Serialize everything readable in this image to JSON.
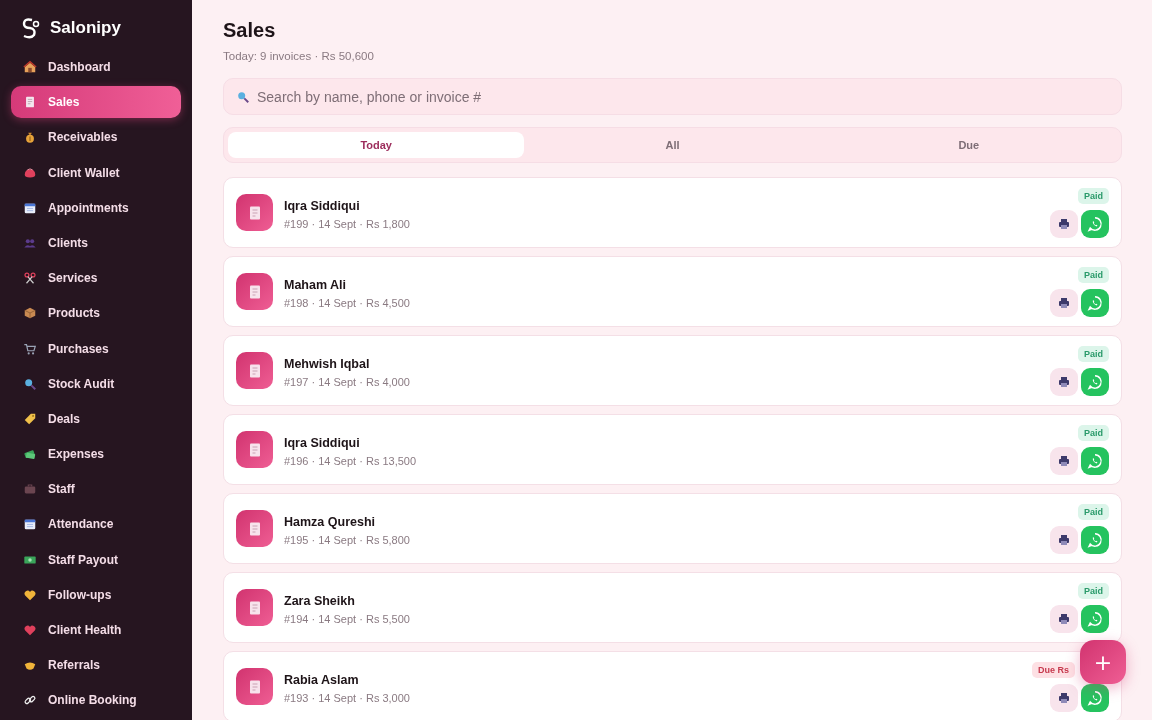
{
  "app": {
    "name": "Salonipy"
  },
  "sidebar": {
    "items": [
      {
        "label": "Dashboard",
        "selected": false
      },
      {
        "label": "Sales",
        "selected": true
      },
      {
        "label": "Receivables",
        "selected": false
      },
      {
        "label": "Client Wallet",
        "selected": false
      },
      {
        "label": "Appointments",
        "selected": false
      },
      {
        "label": "Clients",
        "selected": false
      },
      {
        "label": "Services",
        "selected": false
      },
      {
        "label": "Products",
        "selected": false
      },
      {
        "label": "Purchases",
        "selected": false
      },
      {
        "label": "Stock Audit",
        "selected": false
      },
      {
        "label": "Deals",
        "selected": false
      },
      {
        "label": "Expenses",
        "selected": false
      },
      {
        "label": "Staff",
        "selected": false
      },
      {
        "label": "Attendance",
        "selected": false
      },
      {
        "label": "Staff Payout",
        "selected": false
      },
      {
        "label": "Follow-ups",
        "selected": false
      },
      {
        "label": "Client Health",
        "selected": false
      },
      {
        "label": "Referrals",
        "selected": false
      },
      {
        "label": "Online Booking",
        "selected": false
      }
    ]
  },
  "header": {
    "title": "Sales",
    "subtitle": "Today: 9 invoices · Rs 50,600"
  },
  "search": {
    "placeholder": "Search by name, phone or invoice #"
  },
  "tabs": [
    {
      "label": "Today",
      "selected": true
    },
    {
      "label": "All",
      "selected": false
    },
    {
      "label": "Due",
      "selected": false
    }
  ],
  "invoices": [
    {
      "client": "Iqra Siddiqui",
      "meta": "#199 · 14 Sept · Rs 1,800",
      "status": {
        "kind": "paid",
        "label": "Paid"
      }
    },
    {
      "client": "Maham Ali",
      "meta": "#198 · 14 Sept · Rs 4,500",
      "status": {
        "kind": "paid",
        "label": "Paid"
      }
    },
    {
      "client": "Mehwish Iqbal",
      "meta": "#197 · 14 Sept · Rs 4,000",
      "status": {
        "kind": "paid",
        "label": "Paid"
      }
    },
    {
      "client": "Iqra Siddiqui",
      "meta": "#196 · 14 Sept · Rs 13,500",
      "status": {
        "kind": "paid",
        "label": "Paid"
      }
    },
    {
      "client": "Hamza Qureshi",
      "meta": "#195 · 14 Sept · Rs 5,800",
      "status": {
        "kind": "paid",
        "label": "Paid"
      }
    },
    {
      "client": "Zara Sheikh",
      "meta": "#194 · 14 Sept · Rs 5,500",
      "status": {
        "kind": "paid",
        "label": "Paid"
      }
    },
    {
      "client": "Rabia Aslam",
      "meta": "#193 · 14 Sept · Rs 3,000",
      "status": {
        "kind": "due",
        "label": "Due Rs"
      }
    }
  ],
  "fab": {
    "label": "+"
  }
}
